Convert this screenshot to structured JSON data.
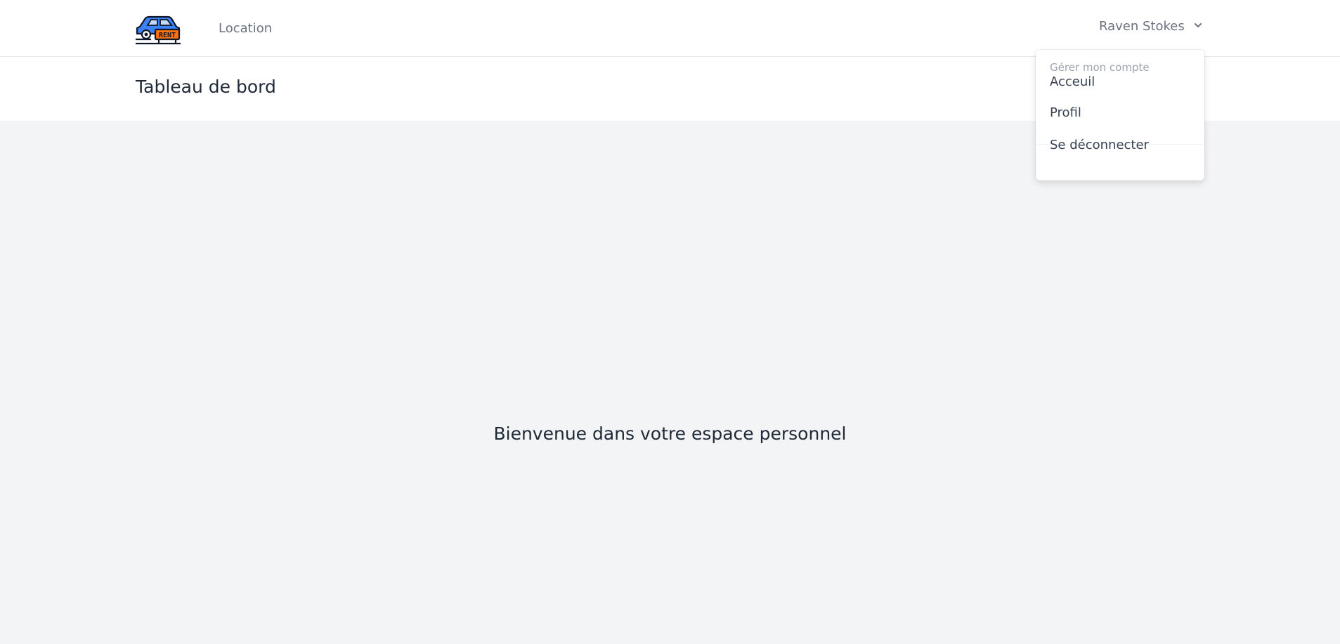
{
  "nav": {
    "logo_icon": "car-rent-icon",
    "logo_text": "RENT",
    "link_location": "Location"
  },
  "user": {
    "name": "Raven Stokes",
    "chevron_icon": "chevron-down-icon"
  },
  "header": {
    "title": "Tableau de bord"
  },
  "main": {
    "welcome": "Bienvenue dans votre espace personnel"
  },
  "dropdown": {
    "header": "Gérer mon compte",
    "items": [
      "Acceuil",
      "Profil",
      "Se déconnecter"
    ]
  },
  "colors": {
    "background": "#f3f4f6",
    "surface": "#ffffff",
    "text": "#1f2937",
    "muted": "#6b7280",
    "car": "#3b82f6",
    "sign": "#f97316"
  }
}
